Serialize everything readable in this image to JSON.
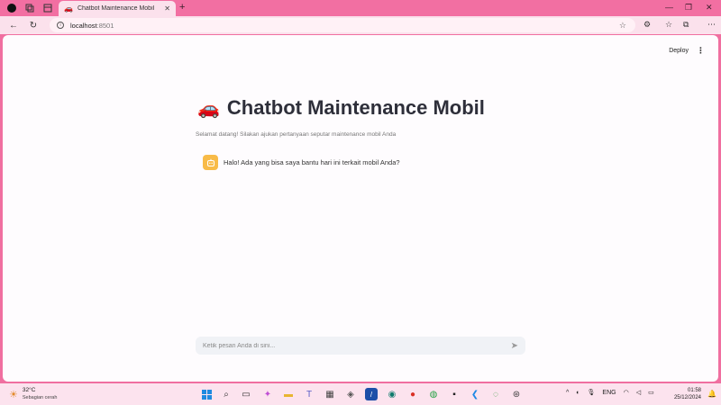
{
  "browser": {
    "tab_title": "Chatbot Maintenance Mobil",
    "tab_emoji": "🚗",
    "address_host": "localhost",
    "address_port": ":8501"
  },
  "page": {
    "deploy_label": "Deploy",
    "title": "Chatbot Maintenance Mobil",
    "title_emoji": "🚗",
    "subtitle": "Selamat datang! Silakan ajukan pertanyaan seputar maintenance mobil Anda",
    "messages": [
      {
        "role": "assistant",
        "text": "Halo! Ada yang bisa saya bantu hari ini terkait mobil Anda?"
      }
    ],
    "chat_placeholder": "Ketik pesan Anda di sini..."
  },
  "taskbar": {
    "temperature": "32°C",
    "weather_condition": "Sebagian cerah",
    "language": "ENG",
    "time": "01:58",
    "date": "25/12/2024"
  },
  "colors": {
    "tab_strip": "#f26fa2",
    "toolbar": "#fbe1ec",
    "page_bg": "#fefcfe",
    "avatar_bg": "#f8bb48",
    "input_bg": "#f0f2f6"
  }
}
